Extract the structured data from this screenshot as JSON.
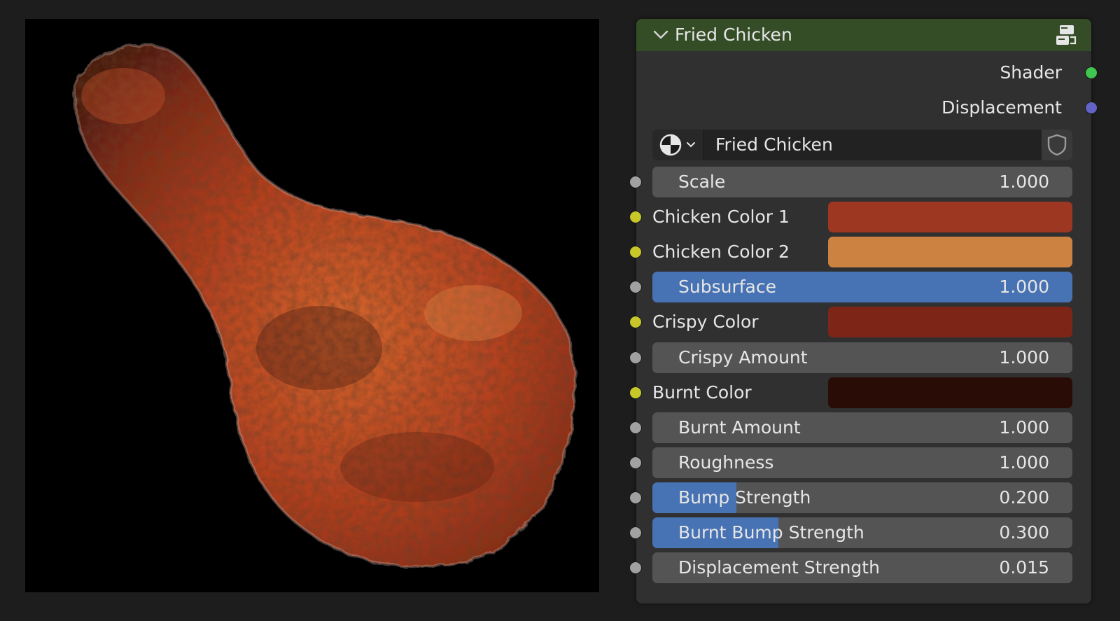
{
  "node": {
    "title": "Fried Chicken",
    "outputs": [
      {
        "label": "Shader",
        "socket_color": "#3fc64f"
      },
      {
        "label": "Displacement",
        "socket_color": "#6363c7"
      }
    ],
    "group": {
      "name": "Fried Chicken"
    },
    "inputs": [
      {
        "kind": "value",
        "label": "Scale",
        "value": "1.000",
        "fill": 0,
        "socket_color": "#a1a1a1"
      },
      {
        "kind": "color",
        "label": "Chicken Color 1",
        "swatch": "#9e3722",
        "socket_color": "#c7c729"
      },
      {
        "kind": "color",
        "label": "Chicken Color 2",
        "swatch": "#cc8241",
        "socket_color": "#c7c729"
      },
      {
        "kind": "value",
        "label": "Subsurface",
        "value": "1.000",
        "fill": 1,
        "socket_color": "#a1a1a1"
      },
      {
        "kind": "color",
        "label": "Crispy Color",
        "swatch": "#7d2516",
        "socket_color": "#c7c729"
      },
      {
        "kind": "value",
        "label": "Crispy Amount",
        "value": "1.000",
        "fill": 0,
        "socket_color": "#a1a1a1"
      },
      {
        "kind": "color",
        "label": "Burnt Color",
        "swatch": "#2a0c07",
        "socket_color": "#c7c729"
      },
      {
        "kind": "value",
        "label": "Burnt Amount",
        "value": "1.000",
        "fill": 0,
        "socket_color": "#a1a1a1"
      },
      {
        "kind": "value",
        "label": "Roughness",
        "value": "1.000",
        "fill": 0,
        "socket_color": "#a1a1a1"
      },
      {
        "kind": "value",
        "label": "Bump Strength",
        "value": "0.200",
        "fill": 0.2,
        "socket_color": "#a1a1a1"
      },
      {
        "kind": "value",
        "label": "Burnt Bump Strength",
        "value": "0.300",
        "fill": 0.3,
        "socket_color": "#a1a1a1"
      },
      {
        "kind": "value",
        "label": "Displacement Strength",
        "value": "0.015",
        "fill": 0,
        "socket_color": "#a1a1a1"
      }
    ]
  },
  "colors": {
    "header": "#344d27",
    "node_bg": "#303030",
    "field_bg": "#545454",
    "fill_accent": "#4772b3"
  }
}
